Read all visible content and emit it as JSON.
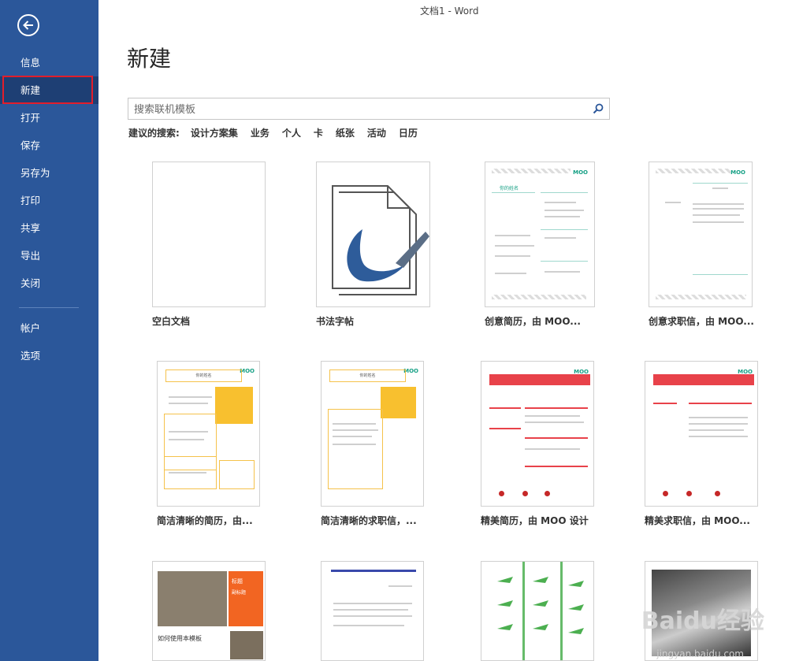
{
  "window": {
    "title": "文档1 - Word"
  },
  "sidebar": {
    "items": [
      {
        "label": "信息"
      },
      {
        "label": "新建"
      },
      {
        "label": "打开"
      },
      {
        "label": "保存"
      },
      {
        "label": "另存为"
      },
      {
        "label": "打印"
      },
      {
        "label": "共享"
      },
      {
        "label": "导出"
      },
      {
        "label": "关闭"
      }
    ],
    "bottom_items": [
      {
        "label": "帐户"
      },
      {
        "label": "选项"
      }
    ]
  },
  "main": {
    "title": "新建",
    "search": {
      "placeholder": "搜索联机模板",
      "value": ""
    },
    "suggestions": {
      "label": "建议的搜索:",
      "links": [
        "设计方案集",
        "业务",
        "个人",
        "卡",
        "纸张",
        "活动",
        "日历"
      ]
    },
    "templates": [
      {
        "label": "空白文档"
      },
      {
        "label": "书法字帖"
      },
      {
        "label": "创意简历，由 MOO..."
      },
      {
        "label": "创意求职信，由 MOO..."
      },
      {
        "label": "简洁清晰的简历，由..."
      },
      {
        "label": "简洁清晰的求职信，..."
      },
      {
        "label": "精美简历，由 MOO 设计"
      },
      {
        "label": "精美求职信，由 MOO..."
      }
    ],
    "thumb_text": {
      "moo": "MOO",
      "name": "你的姓名",
      "doc_heading": "如何使用本模板",
      "flyer_line1": "标题",
      "flyer_line2": "副标题"
    }
  },
  "watermark": {
    "text": "Baidu经验",
    "url": "jingyan.baidu.com"
  }
}
